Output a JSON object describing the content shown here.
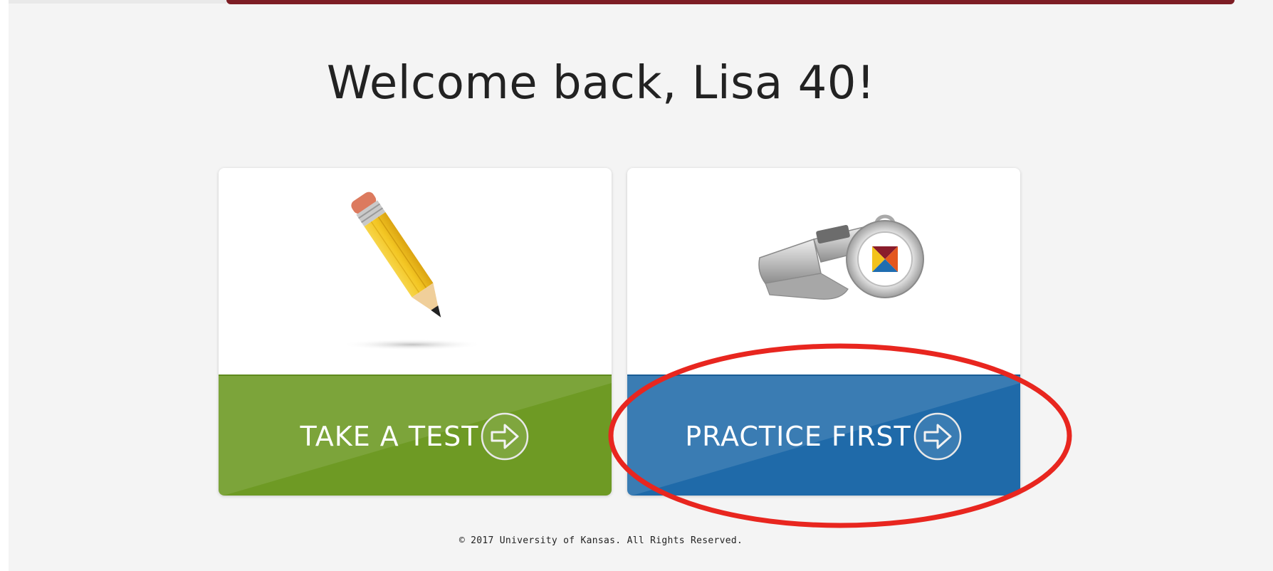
{
  "header": {
    "welcome_text": "Welcome back, Lisa 40!"
  },
  "cards": {
    "take_test": {
      "label": "TAKE A TEST",
      "image_icon": "pencil-icon",
      "arrow_icon": "arrow-right-circle-icon",
      "color": "#6e9a24"
    },
    "practice_first": {
      "label": "PRACTICE FIRST",
      "image_icon": "whistle-icon",
      "arrow_icon": "arrow-right-circle-icon",
      "color": "#1f6aa9"
    }
  },
  "annotation": {
    "type": "red-ellipse-highlight",
    "color": "#e8261f",
    "target": "practice_first"
  },
  "footer": {
    "copyright": "© 2017 University of Kansas. All Rights Reserved."
  },
  "colors": {
    "page_background": "#f4f4f4",
    "top_rule": "#7d1d24"
  }
}
